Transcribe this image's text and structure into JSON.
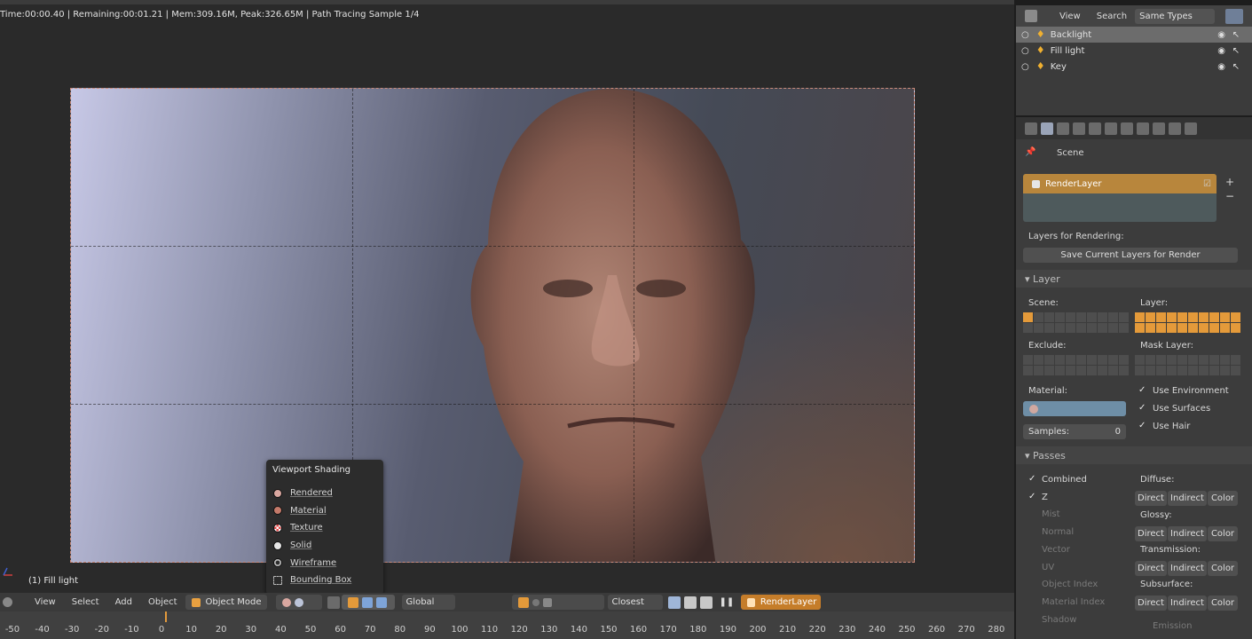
{
  "viewport": {
    "status_text": "Time:00:00.40 | Remaining:00:01.21 | Mem:309.16M, Peak:326.65M | Path Tracing Sample 1/4",
    "active_object_label": "(1) Fill light"
  },
  "shading_menu": {
    "title": "Viewport Shading",
    "items": [
      {
        "label": "Rendered",
        "color": "#d9a7a0"
      },
      {
        "label": "Material",
        "color": "#c47a6a"
      },
      {
        "label": "Texture",
        "color": "#e04a4a"
      },
      {
        "label": "Solid",
        "color": "#e6e6e6"
      },
      {
        "label": "Wireframe",
        "color": "#aaaaaa"
      },
      {
        "label": "Bounding Box",
        "color": "#888888"
      }
    ]
  },
  "header": {
    "view": "View",
    "select": "Select",
    "add": "Add",
    "object": "Object",
    "mode": "Object Mode",
    "orientation": "Global",
    "snap": "Closest",
    "render_layer": "RenderLayer"
  },
  "timeline": {
    "ticks": [
      "-50",
      "-40",
      "-30",
      "-20",
      "-10",
      "0",
      "10",
      "20",
      "30",
      "40",
      "50",
      "60",
      "70",
      "80",
      "90",
      "100",
      "110",
      "120",
      "130",
      "140",
      "150",
      "160",
      "170",
      "180",
      "190",
      "200",
      "210",
      "220",
      "230",
      "240",
      "250",
      "260",
      "270",
      "280"
    ]
  },
  "outliner": {
    "view": "View",
    "search": "Search",
    "filter": "Same Types",
    "rows": [
      {
        "label": "Backlight",
        "selected": true
      },
      {
        "label": "Fill light",
        "selected": false
      },
      {
        "label": "Key",
        "selected": false
      }
    ]
  },
  "properties": {
    "context": "Scene",
    "layer_name": "RenderLayer",
    "layers_for_rendering": "Layers for Rendering:",
    "save_layers_button": "Save Current Layers for Render",
    "layer_panel": "Layer",
    "scene_label": "Scene:",
    "layer_label": "Layer:",
    "exclude_label": "Exclude:",
    "mask_layer_label": "Mask Layer:",
    "material_label": "Material:",
    "use_environment": "Use Environment",
    "use_surfaces": "Use Surfaces",
    "use_hair": "Use Hair",
    "samples_label": "Samples:",
    "samples_value": "0",
    "passes_panel": "Passes",
    "passes_left": [
      "Combined",
      "Z",
      "Mist",
      "Normal",
      "Vector",
      "UV",
      "Object Index",
      "Material Index",
      "Shadow"
    ],
    "passes_left_checked": [
      true,
      true,
      false,
      false,
      false,
      false,
      false,
      false,
      false
    ],
    "diffuse_label": "Diffuse:",
    "glossy_label": "Glossy:",
    "transmission_label": "Transmission:",
    "subsurface_label": "Subsurface:",
    "direct": "Direct",
    "indirect": "Indirect",
    "color": "Color",
    "emission": "Emission"
  }
}
